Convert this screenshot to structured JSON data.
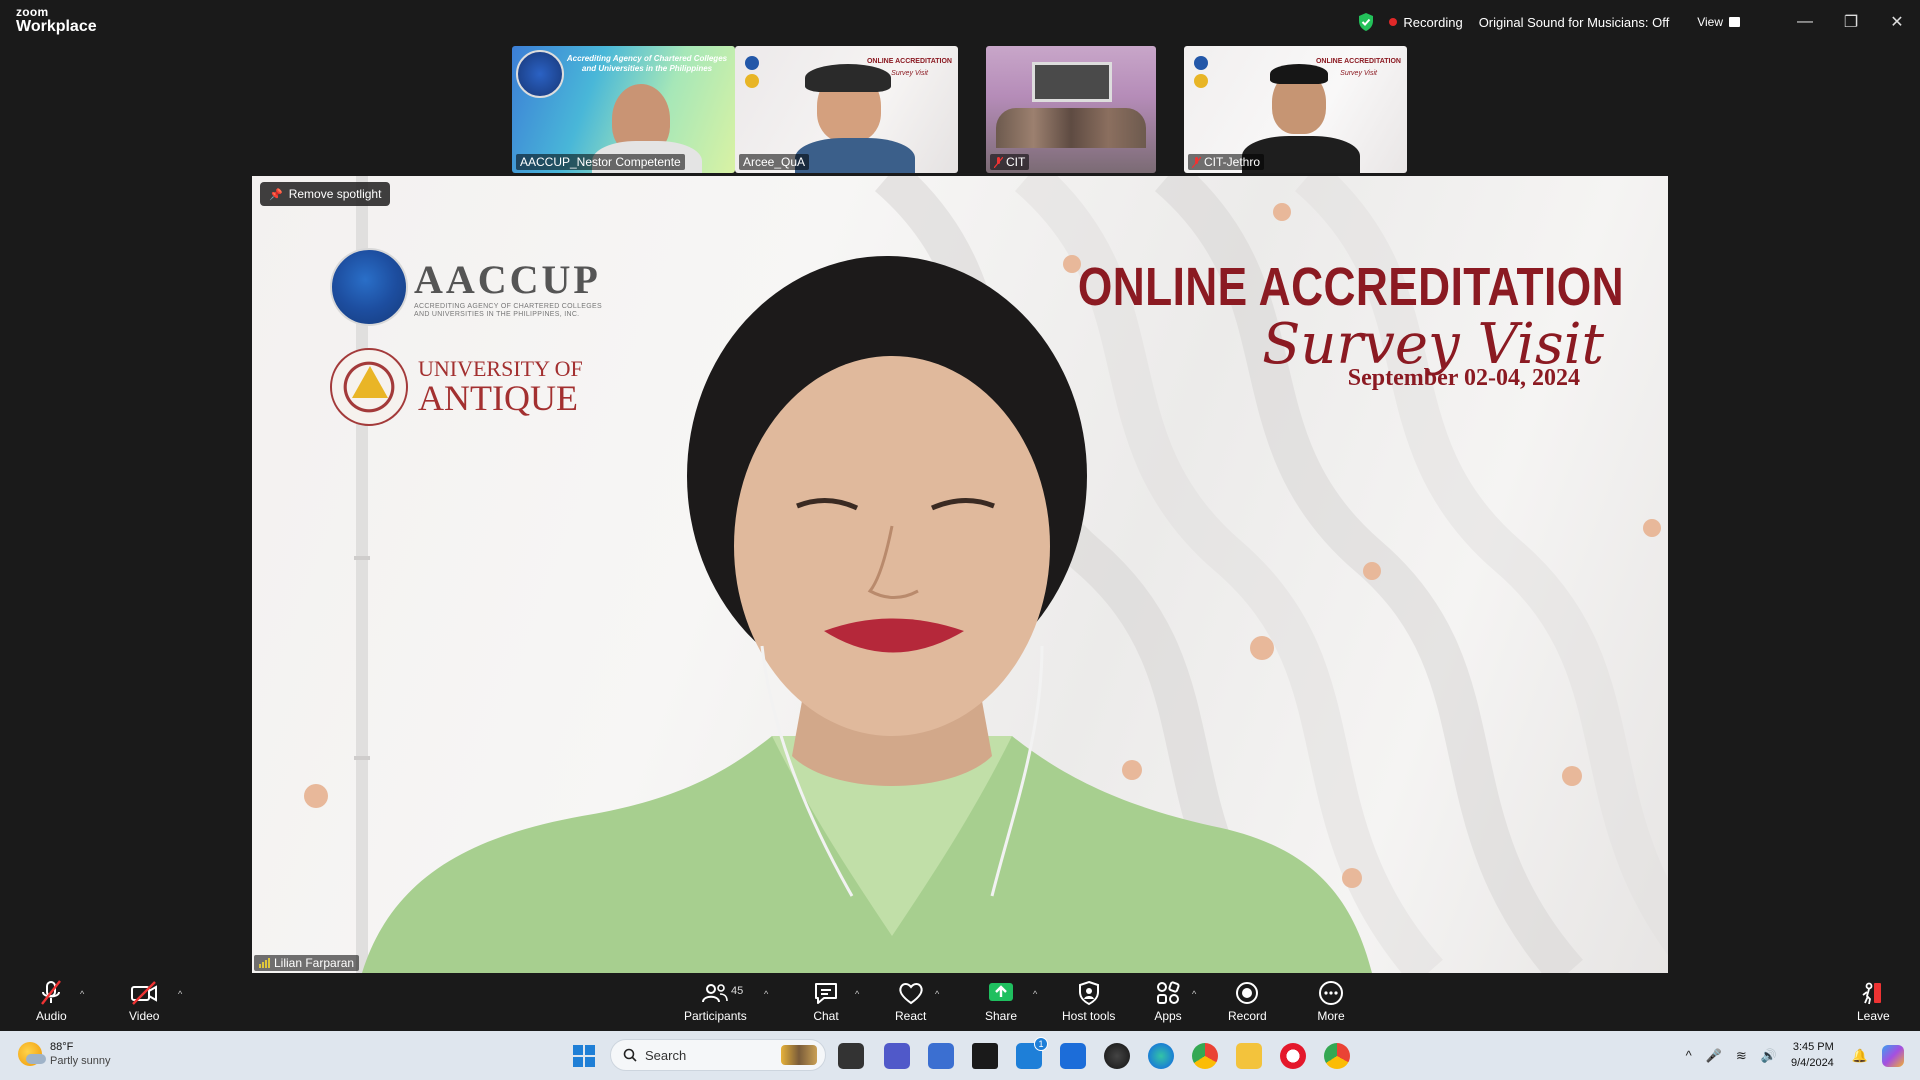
{
  "app": {
    "brand_top": "zoom",
    "brand_bottom": "Workplace"
  },
  "titlebar": {
    "recording_label": "Recording",
    "original_sound": "Original Sound for Musicians: Off",
    "view_label": "View"
  },
  "thumbnails": [
    {
      "name": "AACCUP_Nestor Competente",
      "muted": false,
      "banner_text": "Accrediting Agency of Chartered Colleges and Universities in the Philippines"
    },
    {
      "name": "Arcee_QuA",
      "muted": false
    },
    {
      "name": "CIT",
      "muted": true
    },
    {
      "name": "CIT-Jethro",
      "muted": true
    }
  ],
  "spotlight": {
    "remove_spotlight_label": "Remove spotlight",
    "speaker_name": "Lilian Farparan",
    "logo1_text": "AACCUP",
    "logo1_sub": "ACCREDITING AGENCY OF CHARTERED COLLEGES AND UNIVERSITIES IN THE PHILIPPINES, INC.",
    "logo2_line1": "UNIVERSITY OF",
    "logo2_line2": "ANTIQUE",
    "banner_title": "ONLINE ACCREDITATION",
    "banner_script": "Survey Visit",
    "banner_date": "September 02-04, 2024",
    "mini_banner_1": "ONLINE ACCREDITATION",
    "mini_banner_2": "Survey Visit"
  },
  "toolbar": {
    "audio": "Audio",
    "video": "Video",
    "participants": "Participants",
    "participants_count": "45",
    "chat": "Chat",
    "react": "React",
    "share": "Share",
    "host_tools": "Host tools",
    "apps": "Apps",
    "record": "Record",
    "more": "More",
    "leave": "Leave"
  },
  "taskbar": {
    "temperature": "88°F",
    "weather": "Partly sunny",
    "search_placeholder": "Search",
    "time": "3:45 PM",
    "date": "9/4/2024",
    "mail_badge": "1"
  },
  "colors": {
    "accent_red": "#8b1a22",
    "record_red": "#e02828",
    "share_green": "#1fbf5f",
    "taskbar_bg": "#dfe6ee"
  }
}
